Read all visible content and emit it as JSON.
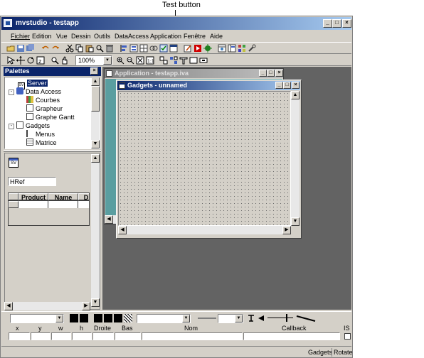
{
  "annotation": {
    "label": "Test button"
  },
  "app": {
    "title": "mvstudio - testapp"
  },
  "menu": [
    "Fichier",
    "Edition",
    "Vue",
    "Dessin",
    "Outils",
    "DataAccess",
    "Application",
    "Fenêtre",
    "Aide"
  ],
  "toolbar2": {
    "zoom": "100%"
  },
  "palettes": {
    "title": "Palettes",
    "tree": [
      {
        "label": "Server",
        "level": 0,
        "selected": true,
        "expander": ""
      },
      {
        "label": "Data Access",
        "level": 0,
        "selected": false,
        "expander": "-"
      },
      {
        "label": "Courbes",
        "level": 1,
        "selected": false,
        "expander": ""
      },
      {
        "label": "Grapheur",
        "level": 1,
        "selected": false,
        "expander": ""
      },
      {
        "label": "Graphe Gantt",
        "level": 1,
        "selected": false,
        "expander": ""
      },
      {
        "label": "Gadgets",
        "level": 0,
        "selected": false,
        "expander": "-"
      },
      {
        "label": "Menus",
        "level": 1,
        "selected": false,
        "expander": ""
      },
      {
        "label": "Matrice",
        "level": 1,
        "selected": false,
        "expander": ""
      }
    ],
    "sv_badge": "SV",
    "href_value": "HRef",
    "table_headers": [
      "Product",
      "Name",
      "D"
    ]
  },
  "app_window": {
    "title": "Application - testapp.iva"
  },
  "gadgets_window": {
    "title": "Gadgets - unnamed"
  },
  "props": {
    "headers": [
      "x",
      "y",
      "w",
      "h",
      "Droite",
      "Bas",
      "Nom",
      "Callback",
      "IS"
    ]
  },
  "status": {
    "mode": "Gadgets",
    "tool": "Rotate"
  }
}
